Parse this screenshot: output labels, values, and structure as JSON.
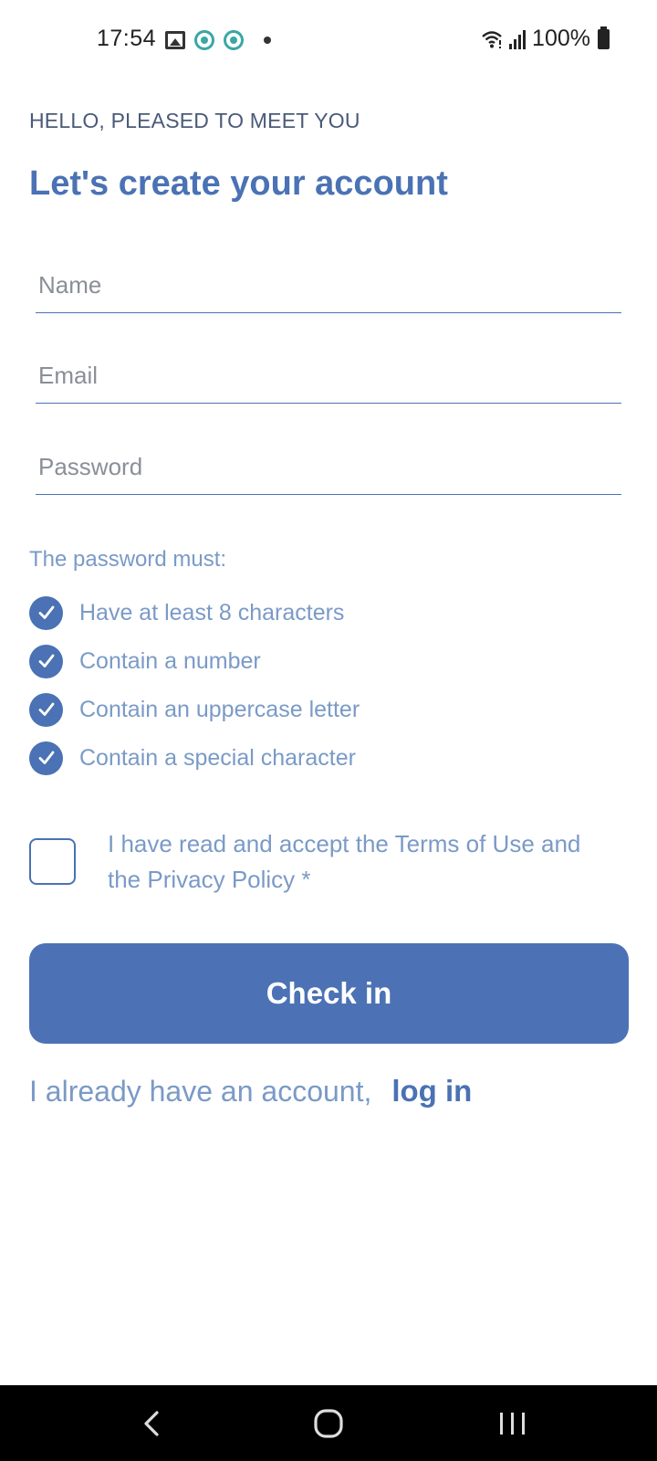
{
  "status_bar": {
    "time": "17:54",
    "battery": "100%",
    "icons": [
      "image-icon",
      "app-icon",
      "app-icon",
      "dot-icon",
      "wifi-icon",
      "signal-icon",
      "battery-icon"
    ]
  },
  "header": {
    "greeting": "HELLO, PLEASED TO MEET YOU",
    "title": "Let's create your account"
  },
  "form": {
    "name_placeholder": "Name",
    "email_placeholder": "Email",
    "password_placeholder": "Password",
    "name_value": "",
    "email_value": "",
    "password_value": ""
  },
  "password_rules": {
    "heading": "The password must:",
    "items": [
      {
        "label": "Have at least 8 characters",
        "met": true
      },
      {
        "label": "Contain a number",
        "met": true
      },
      {
        "label": "Contain an uppercase letter",
        "met": true
      },
      {
        "label": "Contain a special character",
        "met": true
      }
    ]
  },
  "terms": {
    "checked": false,
    "label": "I have read and accept the Terms of Use and the Privacy Policy *"
  },
  "actions": {
    "checkin_label": "Check in",
    "login_prefix": "I already have an account,",
    "login_link": "log in"
  },
  "colors": {
    "accent": "#4a72b4",
    "muted": "#7a9ac7",
    "button": "#4c72b5"
  }
}
